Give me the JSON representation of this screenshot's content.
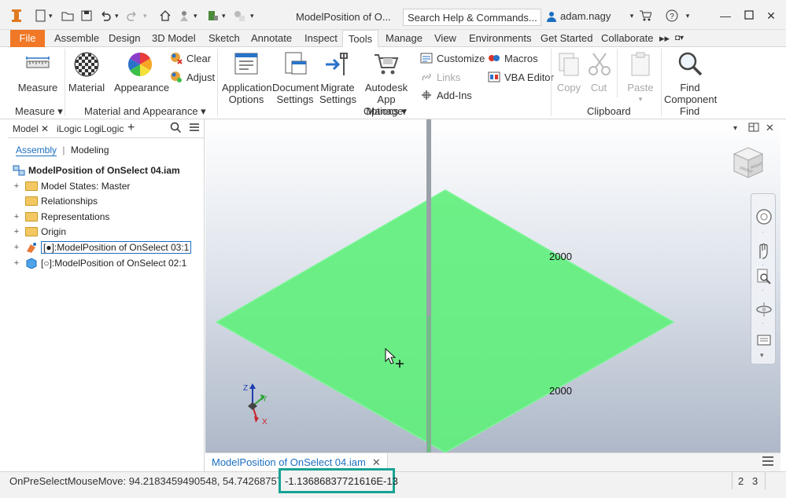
{
  "titlebar": {
    "doc_title": "ModelPosition of O...",
    "search_placeholder": "Search Help & Commands...",
    "user": "adam.nagy"
  },
  "tabs": [
    "File",
    "Assemble",
    "Design",
    "3D Model",
    "Sketch",
    "Annotate",
    "Inspect",
    "Tools",
    "Manage",
    "View",
    "Environments",
    "Get Started",
    "Collaborate"
  ],
  "active_tab": "Tools",
  "ribbon": {
    "measure": "Measure",
    "material": "Material",
    "appearance": "Appearance",
    "clear": "Clear",
    "adjust": "Adjust",
    "application_options": [
      "Application",
      "Options"
    ],
    "document_settings": [
      "Document",
      "Settings"
    ],
    "migrate_settings": [
      "Migrate",
      "Settings"
    ],
    "app_manager": [
      "Autodesk",
      "App Manager"
    ],
    "customize": "Customize",
    "links": "Links",
    "add_ins": "Add-Ins",
    "macros": "Macros",
    "vba_editor": "VBA Editor",
    "copy": "Copy",
    "cut": "Cut",
    "paste": "Paste",
    "find_component": [
      "Find",
      "Component"
    ],
    "panels": {
      "measure": "Measure",
      "material_appearance": "Material and Appearance",
      "options": "Options",
      "clipboard": "Clipboard",
      "find": "Find"
    }
  },
  "browser": {
    "tabs": [
      "Model",
      "iLogic Log",
      "iLogic"
    ],
    "modes": [
      "Assembly",
      "Modeling"
    ],
    "root": "ModelPosition of OnSelect 04.iam",
    "items": [
      "Model States: Master",
      "Relationships",
      "Representations",
      "Origin",
      "[●]:ModelPosition of OnSelect 03:1",
      "[○]:ModelPosition of OnSelect 02:1"
    ]
  },
  "viewport": {
    "dim_top": "2000",
    "dim_bottom": "2000",
    "axes": [
      "Z",
      "Y",
      "X"
    ],
    "viewcube_left": "FRONT",
    "viewcube_right": "RIGHT"
  },
  "doc_tab": "ModelPosition of OnSelect 04.iam",
  "status": {
    "text": "OnPreSelectMouseMove:  94.2183459490548,   54.7426875774246",
    "highlight": "-1.13686837721616E-13",
    "n1": "2",
    "n2": "3"
  },
  "colors": {
    "file_tab": "#f07826",
    "plane": "#5ef07a",
    "highlight_border": "#17a394",
    "accent": "#1c6fbf"
  }
}
